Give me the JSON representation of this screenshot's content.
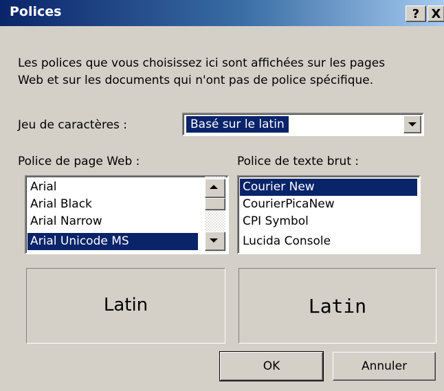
{
  "window": {
    "title": "Polices",
    "help_label": "?",
    "close_label": "X"
  },
  "intro_lines": [
    "Les polices que vous choisissez ici sont affichées sur les pages",
    "Web et sur les documents qui n'ont pas de police spécifique."
  ],
  "charset": {
    "label": "Jeu de caractères :",
    "value": "Basé sur le latin"
  },
  "web_font": {
    "label": "Police de page Web :",
    "items": [
      "Arial",
      "Arial Black",
      "Arial Narrow",
      "Arial Unicode MS"
    ],
    "selected_index": 3
  },
  "plain_font": {
    "label": "Police de texte brut :",
    "items": [
      "Courier New",
      "CourierPicaNew",
      "CPI Symbol",
      "Lucida Console"
    ],
    "selected_index": 0
  },
  "preview": {
    "web_sample": "Latin",
    "plain_sample": "Latin"
  },
  "buttons": {
    "ok": "OK",
    "cancel": "Annuler"
  },
  "icons": {
    "combo_arrow": "chevron-down-icon",
    "scroll_up": "scroll-up-arrow-icon",
    "scroll_down": "scroll-down-arrow-icon"
  },
  "colors": {
    "title_bar": "#0a246a",
    "selection": "#0a246a",
    "dialog_bg": "#d4d0c8"
  }
}
